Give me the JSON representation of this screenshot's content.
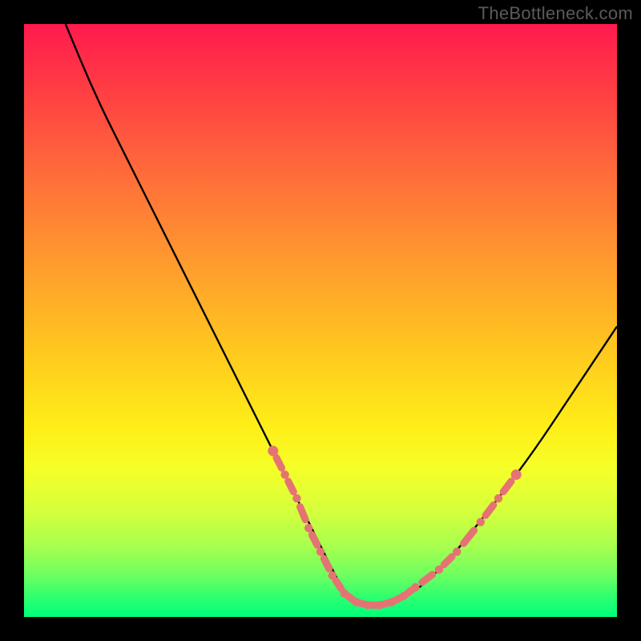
{
  "watermark": "TheBottleneck.com",
  "colors": {
    "background": "#000000",
    "curve": "#000000",
    "markers": "#e57373",
    "gradient_top": "#ff1a4e",
    "gradient_bottom": "#00ff7a"
  },
  "chart_data": {
    "type": "line",
    "title": "",
    "xlabel": "",
    "ylabel": "",
    "xlim": [
      0,
      100
    ],
    "ylim": [
      0,
      100
    ],
    "series": [
      {
        "name": "bottleneck-curve",
        "x": [
          7,
          12,
          18,
          24,
          30,
          36,
          42,
          46,
          50,
          53,
          55,
          57,
          60,
          64,
          68,
          72,
          76,
          80,
          86,
          92,
          100
        ],
        "y": [
          100,
          88,
          76,
          64,
          52,
          40,
          28,
          20,
          12,
          6,
          3,
          2,
          2,
          3,
          6,
          10,
          15,
          20,
          28,
          37,
          49
        ]
      }
    ],
    "markers": {
      "name": "highlighted-range",
      "points": [
        {
          "x": 42,
          "y": 28
        },
        {
          "x": 44,
          "y": 24
        },
        {
          "x": 46,
          "y": 20
        },
        {
          "x": 48,
          "y": 15
        },
        {
          "x": 50,
          "y": 11
        },
        {
          "x": 52,
          "y": 7
        },
        {
          "x": 54,
          "y": 4
        },
        {
          "x": 56,
          "y": 2.5
        },
        {
          "x": 58,
          "y": 2
        },
        {
          "x": 60,
          "y": 2
        },
        {
          "x": 62,
          "y": 2.5
        },
        {
          "x": 64,
          "y": 3.5
        },
        {
          "x": 66,
          "y": 5
        },
        {
          "x": 70,
          "y": 8
        },
        {
          "x": 73,
          "y": 11
        },
        {
          "x": 77,
          "y": 16
        },
        {
          "x": 80,
          "y": 20
        },
        {
          "x": 83,
          "y": 24
        }
      ]
    },
    "background_gradient": "vertical red→yellow→green (bottleneck severity)"
  }
}
